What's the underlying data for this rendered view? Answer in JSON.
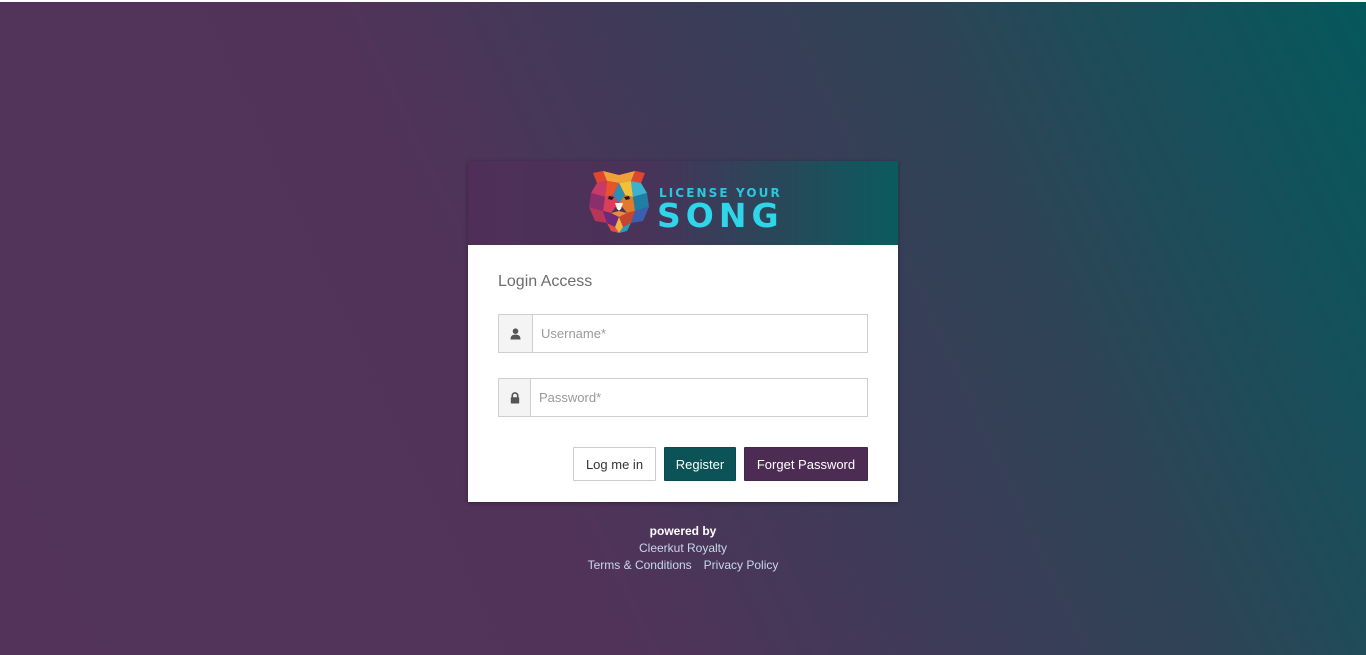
{
  "brand": {
    "tagline": "LICENSE YOUR",
    "name": "SONG",
    "logo_icon": "tiger-head-icon",
    "accent_color": "#2fd6ea"
  },
  "login": {
    "title": "Login Access",
    "username_placeholder": "Username*",
    "password_placeholder": "Password*",
    "username_icon": "user-icon",
    "password_icon": "lock-icon"
  },
  "buttons": {
    "login_label": "Log me in",
    "register_label": "Register",
    "forget_label": "Forget Password",
    "register_color": "#0b5356",
    "forget_color": "#4c2c52"
  },
  "footer": {
    "powered_by": "powered by",
    "company": "Cleerkut Royalty",
    "terms": "Terms & Conditions",
    "privacy": "Privacy Policy"
  }
}
